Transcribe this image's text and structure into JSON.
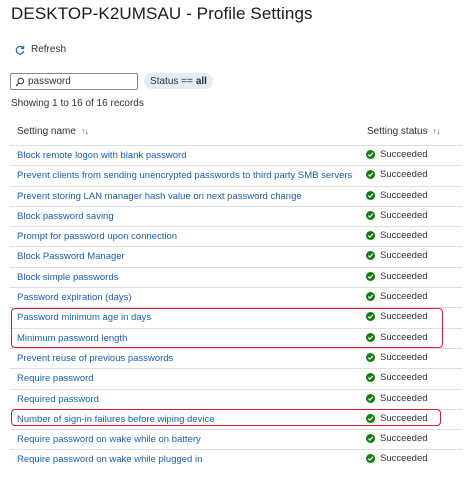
{
  "header": {
    "title": "DESKTOP-K2UMSAU - Profile Settings",
    "more": "···"
  },
  "toolbar": {
    "refresh_label": "Refresh"
  },
  "filter": {
    "search_value": "password",
    "status_prefix": "Status ==",
    "status_value": "all"
  },
  "summary": "Showing 1 to 16 of 16 records",
  "table": {
    "columns": {
      "setting_name": "Setting name",
      "setting_status": "Setting status"
    },
    "rows": [
      {
        "name": "Block remote logon with blank password",
        "status": "Succeeded"
      },
      {
        "name": "Prevent clients from sending unencrypted passwords to third party SMB servers",
        "status": "Succeeded"
      },
      {
        "name": "Prevent storing LAN manager hash value on next password change",
        "status": "Succeeded"
      },
      {
        "name": "Block password saving",
        "status": "Succeeded"
      },
      {
        "name": "Prompt for password upon connection",
        "status": "Succeeded"
      },
      {
        "name": "Block Password Manager",
        "status": "Succeeded"
      },
      {
        "name": "Block simple passwords",
        "status": "Succeeded"
      },
      {
        "name": "Password expiration (days)",
        "status": "Succeeded"
      },
      {
        "name": "Password minimum age in days",
        "status": "Succeeded"
      },
      {
        "name": "Minimum password length",
        "status": "Succeeded"
      },
      {
        "name": "Prevent reuse of previous passwords",
        "status": "Succeeded"
      },
      {
        "name": "Require password",
        "status": "Succeeded"
      },
      {
        "name": "Required password",
        "status": "Succeeded"
      },
      {
        "name": "Number of sign-in failures before wiping device",
        "status": "Succeeded"
      },
      {
        "name": "Require password on wake while on battery",
        "status": "Succeeded"
      },
      {
        "name": "Require password on wake while plugged in",
        "status": "Succeeded"
      }
    ]
  },
  "colors": {
    "link": "#1a5fb4",
    "success": "#107c10",
    "highlight": "#d1202a",
    "pill_bg": "#e3edf9"
  }
}
